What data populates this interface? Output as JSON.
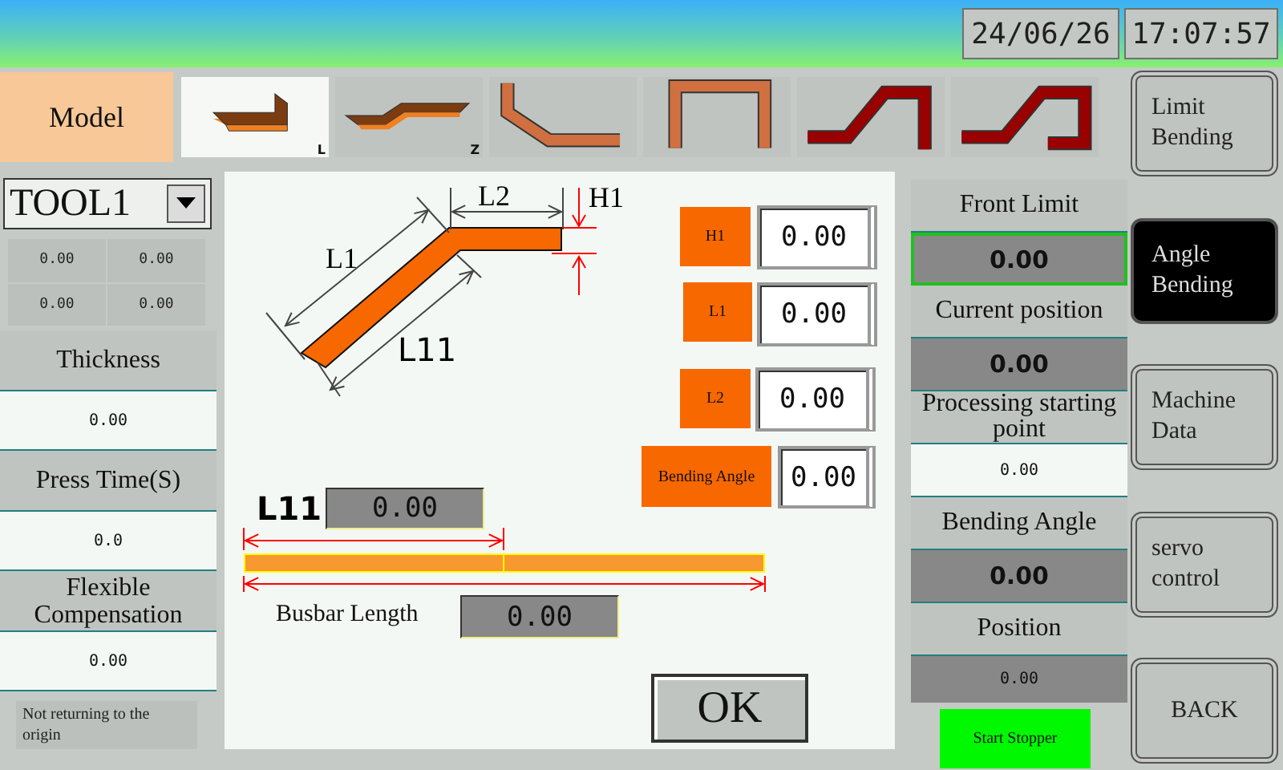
{
  "header": {
    "date": "24/06/26",
    "time": "17:07:57"
  },
  "model_bar": {
    "label": "Model",
    "models": [
      {
        "kind": "l-bend",
        "caption": "L",
        "selected": true
      },
      {
        "kind": "z-bend",
        "caption": "Z",
        "selected": false
      },
      {
        "kind": "angle",
        "selected": false
      },
      {
        "kind": "u-channel",
        "selected": false
      },
      {
        "kind": "offset",
        "selected": false
      },
      {
        "kind": "offset-wide",
        "selected": false
      }
    ]
  },
  "tool": {
    "value": "TOOL1"
  },
  "tool_values": [
    "0.00",
    "0.00",
    "0.00",
    "0.00"
  ],
  "left_params": [
    {
      "label": "Thickness",
      "value": "0.00"
    },
    {
      "label": "Press Time(S)",
      "value": "0.0"
    },
    {
      "label": "Flexible Compensation",
      "value": "0.00"
    }
  ],
  "origin_status": "Not returning to the origin",
  "diagram": {
    "l1": "L1",
    "l2": "L2",
    "h1": "H1",
    "l11": "L11"
  },
  "bend_params": [
    {
      "label": "H1",
      "value": "0.00"
    },
    {
      "label": "L1",
      "value": "0.00"
    },
    {
      "label": "L2",
      "value": "0.00"
    },
    {
      "label": "Bending Angle",
      "value": "0.00"
    }
  ],
  "busbar": {
    "l11_label": "L11",
    "l11_value": "0.00",
    "length_label": "Busbar Length",
    "length_value": "0.00"
  },
  "ok_button": "OK",
  "readings": [
    {
      "label": "Front Limit",
      "value": "0.00",
      "kind": "display",
      "focused": true
    },
    {
      "label": "Current position",
      "value": "0.00",
      "kind": "display",
      "focused": false
    },
    {
      "label": "Processing starting point",
      "value": "0.00",
      "kind": "input",
      "focused": false
    },
    {
      "label": "Bending Angle",
      "value": "0.00",
      "kind": "display",
      "focused": false
    },
    {
      "label": "Position",
      "value": "0.00",
      "kind": "small",
      "focused": false
    }
  ],
  "stopper_button": "Start Stopper",
  "nav": [
    {
      "label": "Limit Bending",
      "selected": false
    },
    {
      "label": "Angle Bending",
      "selected": true
    },
    {
      "label": "Machine Data",
      "selected": false
    },
    {
      "label": "servo control",
      "selected": false
    },
    {
      "label": "BACK",
      "selected": false
    }
  ]
}
